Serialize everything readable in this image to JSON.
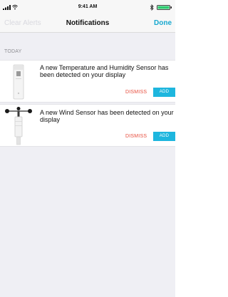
{
  "status_bar": {
    "time": "9:41 AM"
  },
  "nav": {
    "clear_label": "Clear Alerts",
    "title": "Notifications",
    "done_label": "Done"
  },
  "section": {
    "label": "TODAY"
  },
  "notifications": [
    {
      "message": "A new Temperature and Humidity Sensor has been detected on your display",
      "icon": "temperature-humidity-sensor-icon",
      "dismiss_label": "DISMISS",
      "add_label": "ADD"
    },
    {
      "message": "A new Wind Sensor has been detected on your display",
      "icon": "wind-sensor-icon",
      "dismiss_label": "DISMISS",
      "add_label": "ADD"
    }
  ],
  "colors": {
    "accent": "#17a8cf",
    "add_button": "#1eb6de",
    "dismiss": "#e74c3c",
    "disabled": "#d9d9df",
    "background": "#efeff4"
  }
}
